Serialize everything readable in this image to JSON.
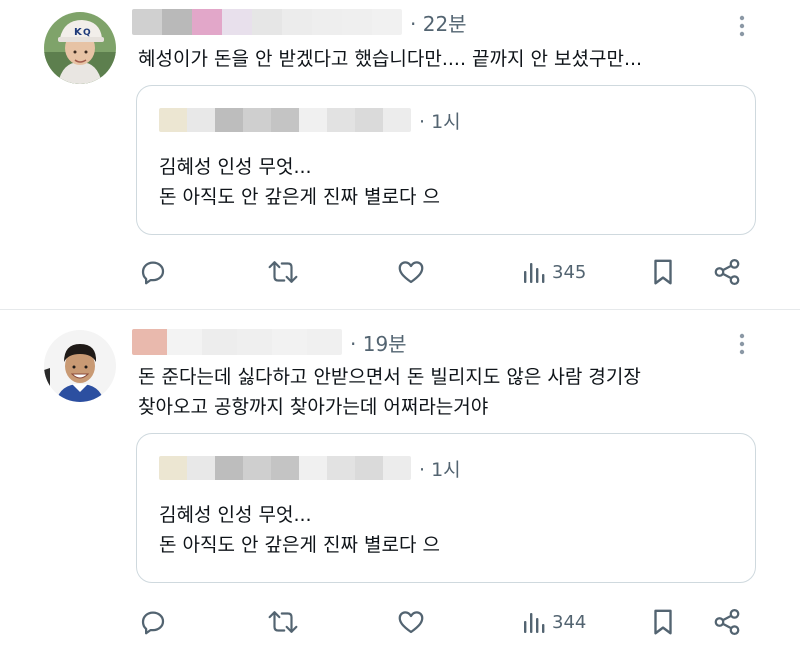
{
  "tweets": [
    {
      "time": "· 22분",
      "text": "혜성이가 돈을 안 받겠다고 했습니다만.... 끝까지 안 보셨구만...",
      "name_blur_colors": [
        "#d0d0d0",
        "#b9b9b9",
        "#e2a7c9",
        "#e8e0ec",
        "#e6e6e6",
        "#ececec",
        "#eeeeee",
        "#efefef",
        "#f1f1f1"
      ],
      "quote": {
        "time": "· 1시",
        "name_blur_colors": [
          "#ece6d2",
          "#e8e8e8",
          "#bdbdbd",
          "#cfcfcf",
          "#c4c4c4",
          "#f0f0f0",
          "#e2e2e2",
          "#dadada",
          "#ececec"
        ],
        "lines": [
          "김혜성 인성 무엇...",
          "돈 아직도 안 갚은게 진짜 별로다 으"
        ]
      },
      "views": "345"
    },
    {
      "time": "· 19분",
      "text_lines": [
        "돈 준다는데 싫다하고 안받으면서 돈 빌리지도 않은 사람 경기장",
        "찾아오고 공항까지 찾아가는데 어쩌라는거야"
      ],
      "name_blur_colors": [
        "#e9b9ad",
        "#f3f3f3",
        "#ededed",
        "#efefef",
        "#f2f2f2",
        "#f0f0f0"
      ],
      "quote": {
        "time": "· 1시",
        "name_blur_colors": [
          "#ece6d2",
          "#e8e8e8",
          "#bdbdbd",
          "#cfcfcf",
          "#c4c4c4",
          "#f0f0f0",
          "#e2e2e2",
          "#dadada",
          "#ececec"
        ],
        "lines": [
          "김혜성 인성 무엇...",
          "돈 아직도 안 갚은게 진짜 별로다 으"
        ]
      },
      "views": "344"
    }
  ],
  "icons": {
    "more": "more-vertical-icon",
    "reply": "reply-icon",
    "retweet": "retweet-icon",
    "like": "heart-icon",
    "views": "views-chart-icon",
    "bookmark": "bookmark-icon",
    "share": "share-icon"
  },
  "colors": {
    "text": "#0f1419",
    "secondary": "#536471",
    "border": "#cfd9de"
  }
}
